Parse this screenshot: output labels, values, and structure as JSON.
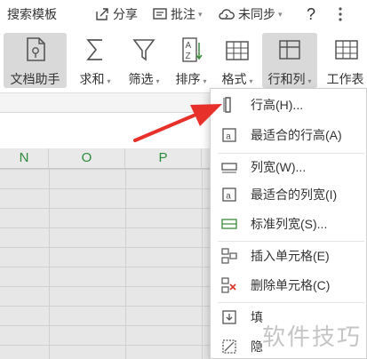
{
  "topbar": {
    "search_templates": "搜索模板",
    "share": "分享",
    "comment": "批注",
    "sync": "未同步",
    "help": "?",
    "more_icon": "vertical-dots-icon"
  },
  "ribbon": {
    "buttons": [
      {
        "label": "文档助手",
        "icon": "document-assistant-icon",
        "active": true
      },
      {
        "label": "求和",
        "icon": "sigma-icon",
        "has_dropdown": true
      },
      {
        "label": "筛选",
        "icon": "funnel-icon",
        "has_dropdown": true
      },
      {
        "label": "排序",
        "icon": "sort-az-icon",
        "has_dropdown": true
      },
      {
        "label": "格式",
        "icon": "format-icon",
        "has_dropdown": true
      },
      {
        "label": "行和列",
        "icon": "rows-columns-icon",
        "has_dropdown": true,
        "active": true
      },
      {
        "label": "工作表",
        "icon": "worksheet-icon"
      }
    ]
  },
  "sheet": {
    "columns": [
      "N",
      "O",
      "P"
    ],
    "header_text_color": "#2a8b3a"
  },
  "menu": {
    "items": [
      {
        "label": "行高(H)...",
        "icon": "row-height-icon"
      },
      {
        "label": "最适合的行高(A)",
        "icon": "autofit-row-height-icon"
      },
      {
        "label": "列宽(W)...",
        "icon": "column-width-icon"
      },
      {
        "label": "最适合的列宽(I)",
        "icon": "autofit-column-width-icon"
      },
      {
        "label": "标准列宽(S)...",
        "icon": "standard-column-width-icon"
      },
      {
        "label": "插入单元格(E)",
        "icon": "insert-cells-icon"
      },
      {
        "label": "删除单元格(C)",
        "icon": "delete-cells-icon"
      },
      {
        "label": "填",
        "icon": "fill-icon"
      },
      {
        "label": "隐",
        "icon": "hide-icon"
      }
    ]
  },
  "annotation": {
    "arrow_color": "#e8302a"
  },
  "watermark": "软件技巧"
}
